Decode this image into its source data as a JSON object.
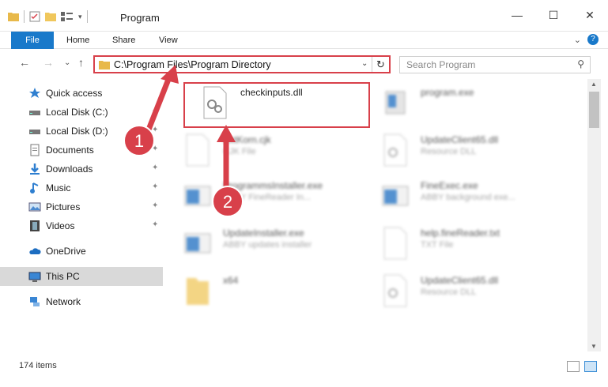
{
  "window": {
    "title": "Program",
    "minimize": "—",
    "maximize": "☐",
    "close": "✕"
  },
  "ribbon": {
    "file": "File",
    "home": "Home",
    "share": "Share",
    "view": "View",
    "expand": "⌄",
    "help": "?"
  },
  "nav": {
    "back": "←",
    "forward": "→",
    "recent": "⌄",
    "up": "↑",
    "address": "C:\\Program Files\\Program Directory",
    "address_dropdown": "⌄",
    "refresh": "↻",
    "search_placeholder": "Search Program",
    "search_icon": "⚲"
  },
  "sidebar": {
    "items": [
      {
        "label": "Quick access",
        "icon": "star-icon",
        "pinned": false
      },
      {
        "label": "Local Disk (C:)",
        "icon": "drive-icon",
        "pinned": true
      },
      {
        "label": "Local Disk (D:)",
        "icon": "drive-icon",
        "pinned": true
      },
      {
        "label": "Documents",
        "icon": "documents-icon",
        "pinned": true
      },
      {
        "label": "Downloads",
        "icon": "download-icon",
        "pinned": true
      },
      {
        "label": "Music",
        "icon": "music-icon",
        "pinned": true
      },
      {
        "label": "Pictures",
        "icon": "pictures-icon",
        "pinned": true
      },
      {
        "label": "Videos",
        "icon": "videos-icon",
        "pinned": true
      },
      {
        "label": "OneDrive",
        "icon": "cloud-icon",
        "pinned": false
      },
      {
        "label": "This PC",
        "icon": "computer-icon",
        "pinned": false,
        "selected": true
      },
      {
        "label": "Network",
        "icon": "network-icon",
        "pinned": false
      }
    ],
    "pin_glyph": "📌"
  },
  "files": [
    {
      "name": "checkinputs.dll",
      "desc": ""
    },
    {
      "name": "program.exe",
      "desc": ""
    },
    {
      "name": "ExtKorn.cjk",
      "desc": "CJK File"
    },
    {
      "name": "UpdateClient65.dll",
      "desc": "Resource DLL"
    },
    {
      "name": "ProgrammsInstaller.exe",
      "desc": "ABBY FineReader In..."
    },
    {
      "name": "FineExec.exe",
      "desc": "ABBY background exe..."
    },
    {
      "name": "UpdateInstaller.exe",
      "desc": "ABBY updates installer"
    },
    {
      "name": "help.fineReader.txt",
      "desc": "TXT File"
    },
    {
      "name": "x64",
      "desc": ""
    },
    {
      "name": "UpdateClient65.dll",
      "desc": "Resource DLL"
    }
  ],
  "status": {
    "item_count": "174 items"
  },
  "annotations": {
    "step1": "1",
    "step2": "2",
    "color": "#d8404a"
  }
}
